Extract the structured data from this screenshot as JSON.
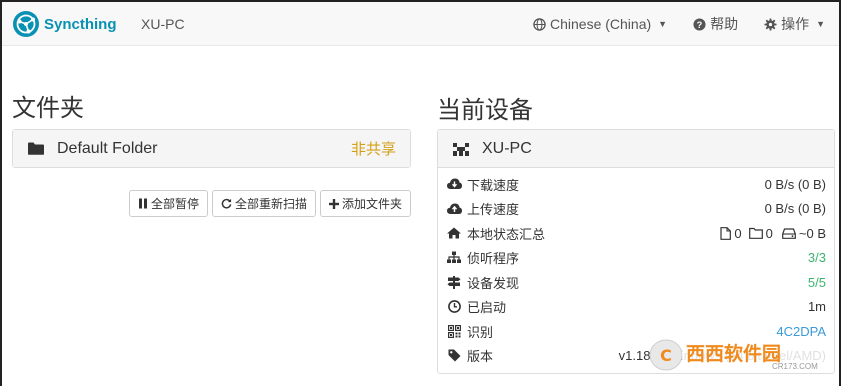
{
  "navbar": {
    "brand": "Syncthing",
    "device_name": "XU-PC",
    "language": "Chinese (China)",
    "help": "帮助",
    "actions": "操作"
  },
  "folders": {
    "title": "文件夹",
    "items": [
      {
        "name": "Default Folder",
        "status": "非共享"
      }
    ],
    "buttons": {
      "pause_all": "全部暂停",
      "rescan_all": "全部重新扫描",
      "add_folder": "添加文件夹"
    }
  },
  "this_device": {
    "title": "当前设备",
    "name": "XU-PC",
    "stats": {
      "download_label": "下载速度",
      "download_value": "0 B/s (0 B)",
      "upload_label": "上传速度",
      "upload_value": "0 B/s (0 B)",
      "local_state_label": "本地状态汇总",
      "local_files": "0",
      "local_dirs": "0",
      "local_size": "~0 B",
      "listeners_label": "侦听程序",
      "listeners_value": "3/3",
      "discovery_label": "设备发现",
      "discovery_value": "5/5",
      "uptime_label": "已启动",
      "uptime_value": "1m",
      "id_label": "识别",
      "id_value": "4C2DPA",
      "version_label": "版本",
      "version_value": "v1.18.2, Windows (64 bit Intel/AMD)"
    }
  },
  "watermark": {
    "text": "西西软件园",
    "url": "CR173.COM"
  },
  "colors": {
    "brand": "#0891b2",
    "unshared": "#d4a017",
    "ok": "#3cb371",
    "link": "#3a9ad9"
  }
}
